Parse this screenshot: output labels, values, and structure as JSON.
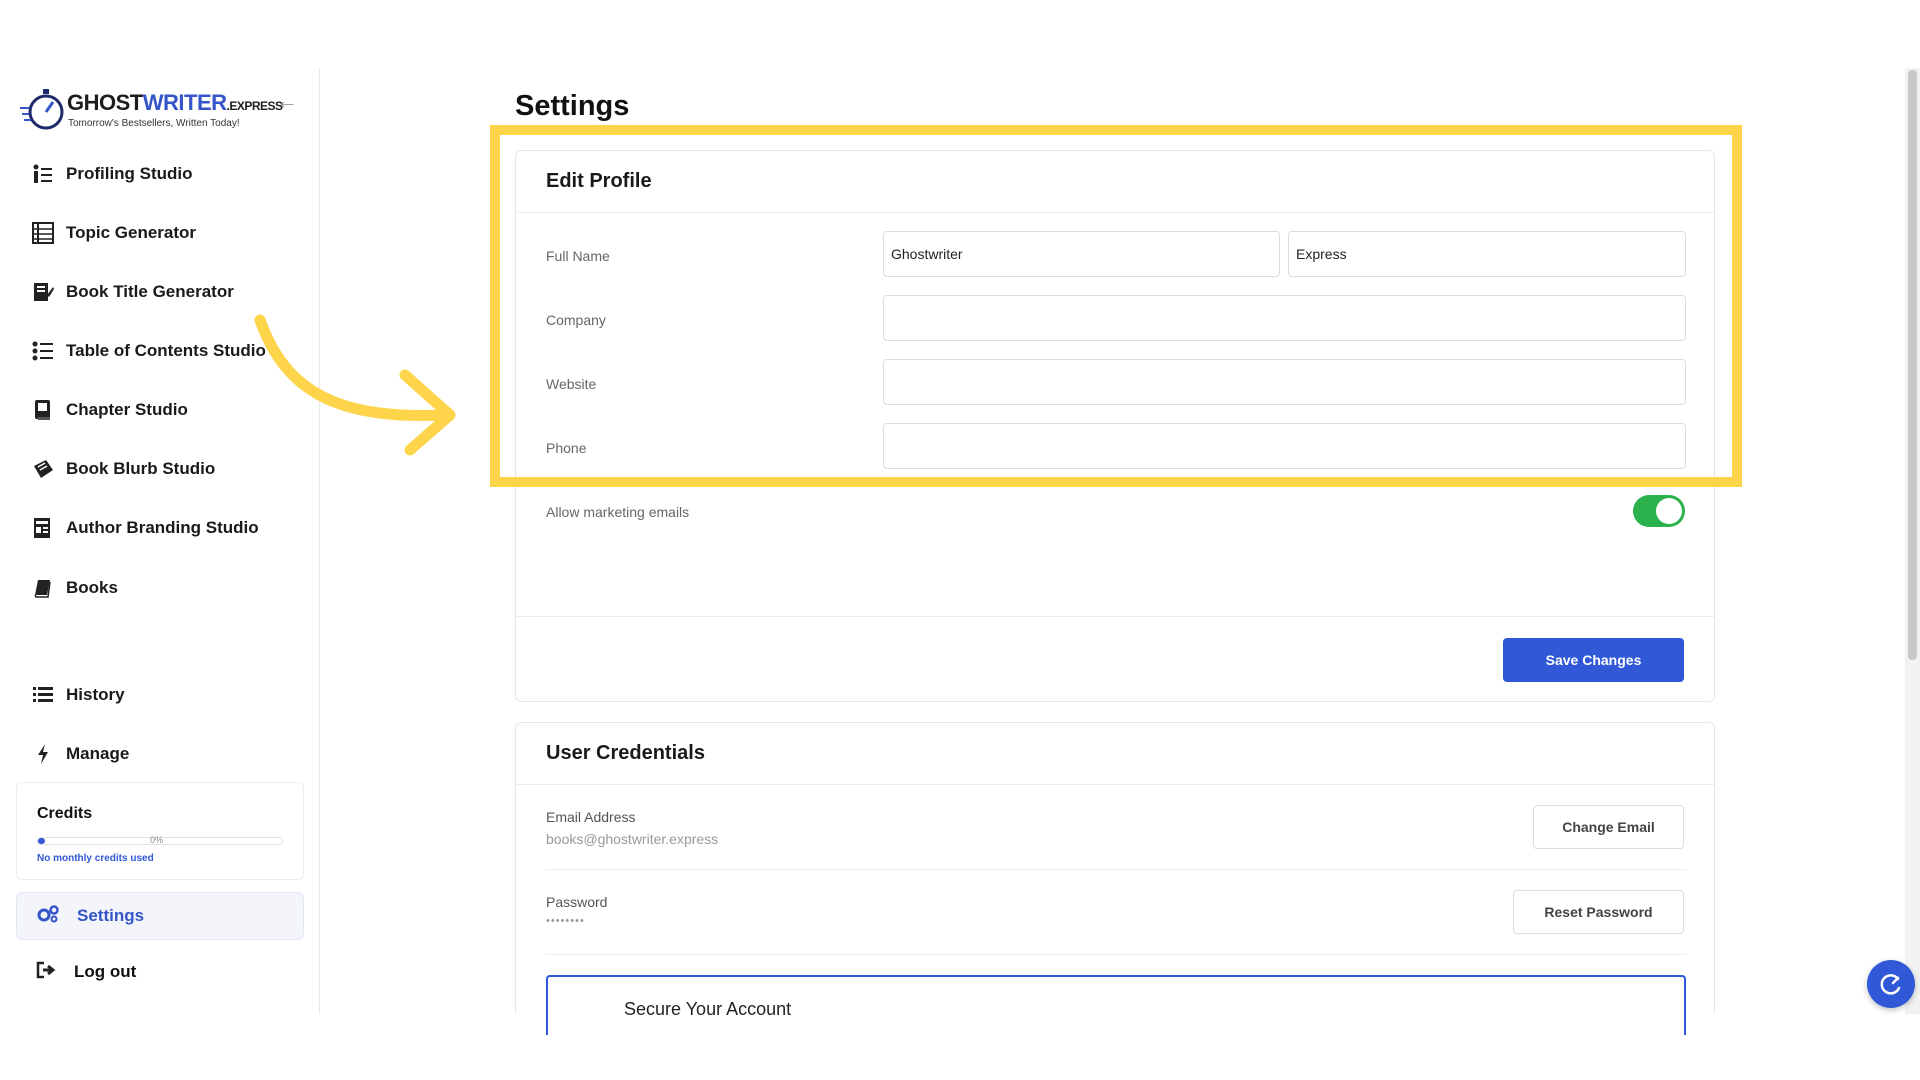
{
  "brand": {
    "logo_main": "GHOST",
    "logo_accent": "WRITER",
    "logo_suffix": ".EXPRESS",
    "tagline": "Tomorrow's Bestsellers, Written Today!"
  },
  "sidebar": {
    "items": [
      {
        "label": "Profiling Studio",
        "icon": "profile-list-icon"
      },
      {
        "label": "Topic Generator",
        "icon": "topic-grid-icon"
      },
      {
        "label": "Book Title Generator",
        "icon": "book-edit-icon"
      },
      {
        "label": "Table of Contents Studio",
        "icon": "toc-list-icon"
      },
      {
        "label": "Chapter Studio",
        "icon": "chapter-book-icon"
      },
      {
        "label": "Book Blurb Studio",
        "icon": "blurb-book-icon"
      },
      {
        "label": "Author Branding Studio",
        "icon": "branding-icon"
      },
      {
        "label": "Books",
        "icon": "book-icon"
      }
    ],
    "history": "History",
    "manage": "Manage",
    "credits": {
      "title": "Credits",
      "percent_label": "0%",
      "progress": 0.03,
      "note": "No monthly credits used"
    },
    "settings": "Settings",
    "logout": "Log out"
  },
  "page": {
    "title": "Settings"
  },
  "edit_profile": {
    "title": "Edit Profile",
    "full_name_label": "Full Name",
    "first_name": "Ghostwriter",
    "last_name": "Express",
    "company_label": "Company",
    "company_value": "",
    "website_label": "Website",
    "website_value": "",
    "phone_label": "Phone",
    "phone_value": "",
    "marketing_label": "Allow marketing emails",
    "marketing_enabled": true,
    "save_label": "Save Changes"
  },
  "credentials": {
    "title": "User Credentials",
    "email_label": "Email Address",
    "email_value": "books@ghostwriter.express",
    "change_email": "Change Email",
    "password_label": "Password",
    "password_value": "••••••••",
    "reset_password": "Reset Password",
    "secure_title": "Secure Your Account"
  },
  "colors": {
    "accent": "#3158d6",
    "highlight": "#fdd44a",
    "toggle_on": "#2bb24c"
  }
}
